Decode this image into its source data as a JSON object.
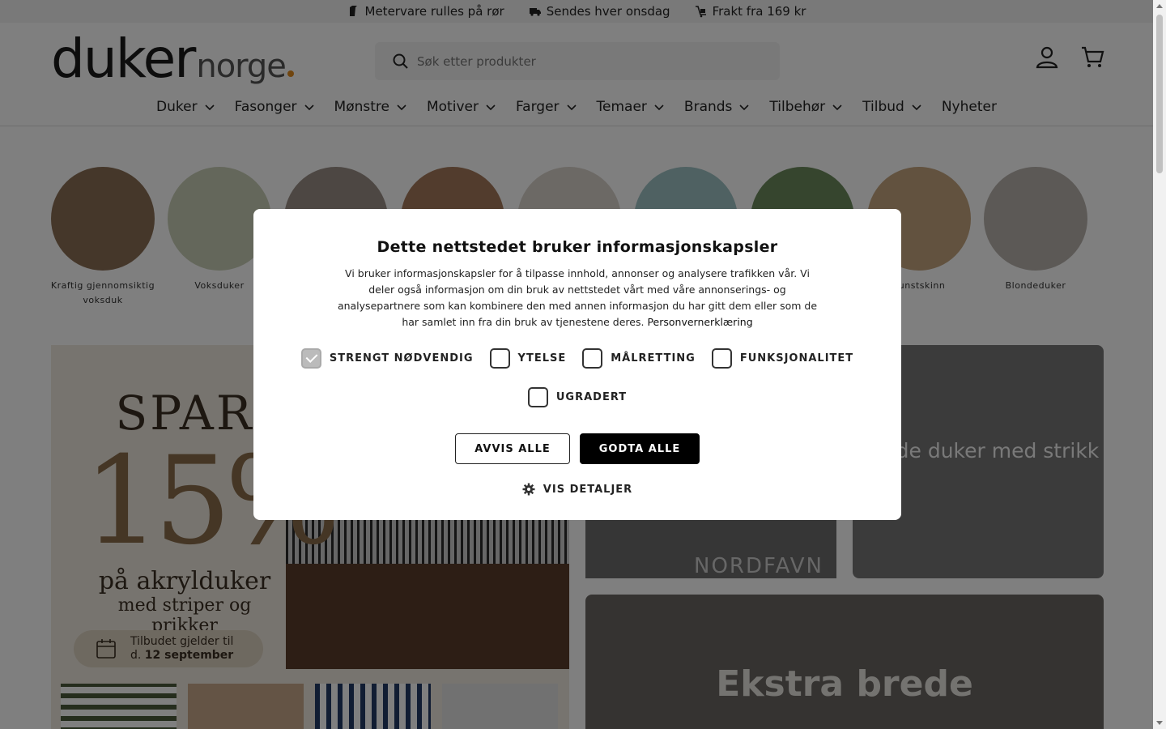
{
  "announcement": {
    "items": [
      {
        "icon": "roll-icon",
        "text": "Metervare rulles på rør"
      },
      {
        "icon": "truck-icon",
        "text": "Sendes hver onsdag"
      },
      {
        "icon": "delivery-icon",
        "text": "Frakt fra 169 kr"
      }
    ]
  },
  "header": {
    "logo_main": "duker",
    "logo_sub": "norge",
    "search_placeholder": "Søk etter produkter",
    "account_icon": "user-icon",
    "cart_icon": "cart-icon"
  },
  "nav": {
    "items": [
      {
        "label": "Duker",
        "dropdown": true
      },
      {
        "label": "Fasonger",
        "dropdown": true
      },
      {
        "label": "Mønstre",
        "dropdown": true
      },
      {
        "label": "Motiver",
        "dropdown": true
      },
      {
        "label": "Farger",
        "dropdown": true
      },
      {
        "label": "Temaer",
        "dropdown": true
      },
      {
        "label": "Brands",
        "dropdown": true
      },
      {
        "label": "Tilbehør",
        "dropdown": true
      },
      {
        "label": "Tilbud",
        "dropdown": true
      },
      {
        "label": "Nyheter",
        "dropdown": false
      }
    ]
  },
  "categories": [
    {
      "label": "Kraftig gjennomsiktig voksduk",
      "color": "#8a6e55"
    },
    {
      "label": "Voksduker",
      "color": "#c9cfb6"
    },
    {
      "label": "",
      "color": "#9a8f86"
    },
    {
      "label": "",
      "color": "#a4795a"
    },
    {
      "label": "",
      "color": "#d8d2cb"
    },
    {
      "label": "",
      "color": "#9fc3c4"
    },
    {
      "label": "",
      "color": "#6c8a5d"
    },
    {
      "label": "Kunstskinn",
      "color": "#c4a57f"
    },
    {
      "label": "Blondeduker",
      "color": "#b8b3ad"
    }
  ],
  "banners": {
    "promo": {
      "spar": "SPAR",
      "percent": "15%",
      "line1": "på akrylduker",
      "line2": "med striper og prikker",
      "valid_line1": "Tilbudet gjelder til",
      "valid_prefix": "d.",
      "valid_date": "12 september"
    },
    "nordfavn": "NORDFAVN",
    "round_tablecloths": "Runde duker med strikk",
    "wide": "Ekstra brede"
  },
  "cookie": {
    "title": "Dette nettstedet bruker informasjonskapsler",
    "description": "Vi bruker informasjonskapsler for å tilpasse innhold, annonser og analysere trafikken vår. Vi deler også informasjon om din bruk av nettstedet vårt med våre annonserings- og analysepartnere som kan kombinere den med annen informasjon du har gitt dem eller som de har samlet inn fra din bruk av tjenestene deres.",
    "privacy_link": "Personvernerklæring",
    "checkboxes": [
      {
        "label": "STRENGT NØDVENDIG",
        "checked": true
      },
      {
        "label": "YTELSE",
        "checked": false
      },
      {
        "label": "MÅLRETTING",
        "checked": false
      },
      {
        "label": "FUNKSJONALITET",
        "checked": false
      },
      {
        "label": "UGRADERT",
        "checked": false
      }
    ],
    "reject_label": "AVVIS ALLE",
    "accept_label": "GODTA ALLE",
    "details_label": "VIS DETALJER"
  },
  "colors": {
    "accent": "#e08a1e",
    "button_dark": "#000000"
  }
}
